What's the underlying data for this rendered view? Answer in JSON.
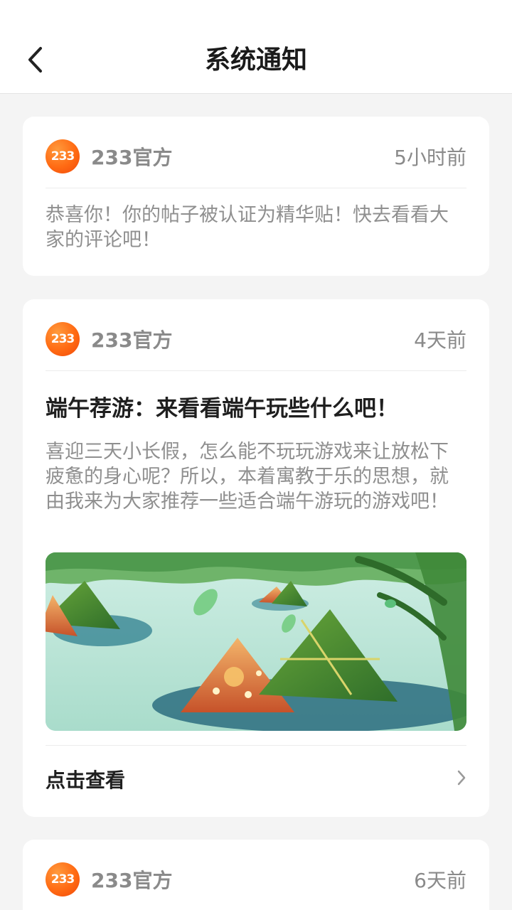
{
  "header": {
    "title": "系统通知"
  },
  "notifications": [
    {
      "logo_text": "233",
      "sender": "233官方",
      "time": "5小时前",
      "body": "恭喜你！你的帖子被认证为精华贴！快去看看大家的评论吧！"
    },
    {
      "logo_text": "233",
      "sender": "233官方",
      "time": "4天前",
      "title": "端午荐游：来看看端午玩些什么吧！",
      "body": "喜迎三天小长假，怎么能不玩玩游戏来让放松下疲惫的身心呢？所以，本着寓教于乐的思想，就由我来为大家推荐一些适合端午游玩的游戏吧！",
      "view_label": "点击查看"
    },
    {
      "logo_text": "233",
      "sender": "233官方",
      "time": "6天前"
    }
  ],
  "icons": {
    "back": "chevron-left-icon",
    "view": "chevron-right-icon"
  },
  "colors": {
    "brand_orange": "#ff6a13",
    "background": "#f4f4f4",
    "card": "#ffffff",
    "muted_text": "#8a8a8a"
  }
}
